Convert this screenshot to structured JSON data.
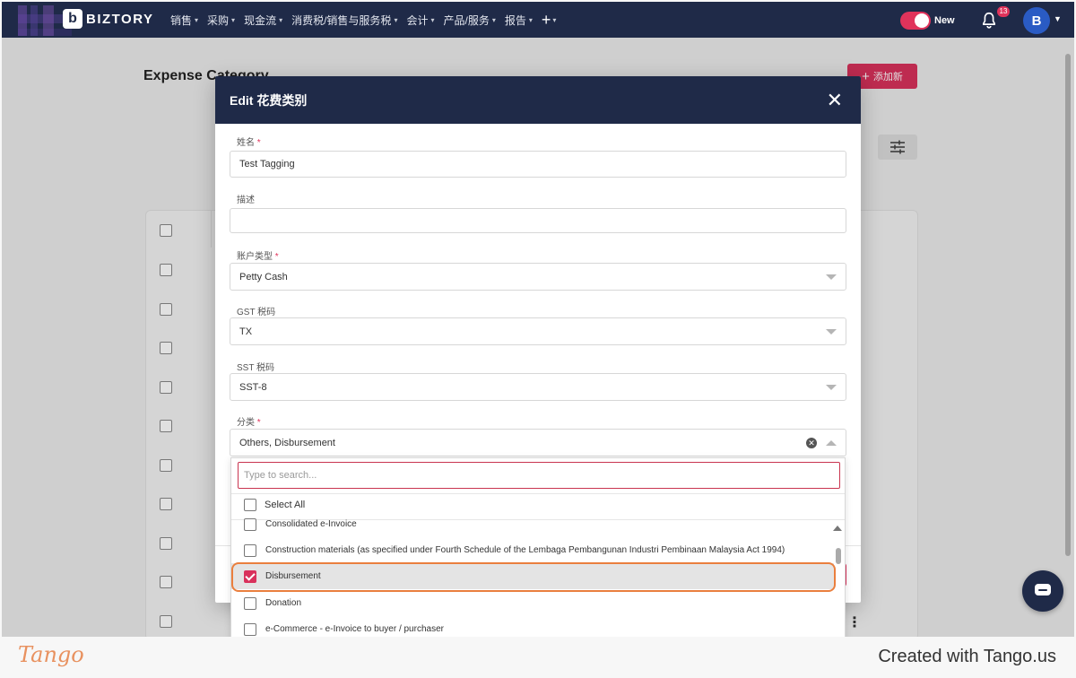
{
  "navbar": {
    "brand": "BIZTORY",
    "logo_letter": "b",
    "menu": [
      {
        "label": "销售"
      },
      {
        "label": "采购"
      },
      {
        "label": "现金流"
      },
      {
        "label": "消费税/销售与服务税"
      },
      {
        "label": "会计"
      },
      {
        "label": "产品/服务"
      },
      {
        "label": "报告"
      }
    ],
    "plus_label": "+",
    "toggle_label": "New",
    "notification_count": "13",
    "avatar_initial": "B"
  },
  "page": {
    "title": "Expense Category",
    "add_button": "添加新",
    "add_button_icon": "+"
  },
  "modal": {
    "title": "Edit 花费类别",
    "close": "✕",
    "fields": {
      "name_label": "姓名",
      "name_value": "Test Tagging",
      "description_label": "描述",
      "description_value": "",
      "account_type_label": "账户类型",
      "account_type_value": "Petty Cash",
      "gst_label": "GST 税码",
      "gst_value": "TX",
      "sst_label": "SST 税码",
      "sst_value": "SST-8",
      "category_label": "分类",
      "category_value": "Others, Disbursement",
      "required_mark": "*"
    }
  },
  "dropdown": {
    "search_placeholder": "Type to search...",
    "select_all": "Select All",
    "options": [
      {
        "label": "Consolidated e-Invoice",
        "checked": false
      },
      {
        "label": "Construction materials (as specified under Fourth Schedule of the Lembaga Pembangunan Industri Pembinaan Malaysia Act 1994)",
        "checked": false
      },
      {
        "label": "Disbursement",
        "checked": true
      },
      {
        "label": "Donation",
        "checked": false
      },
      {
        "label": "e-Commerce - e-Invoice to buyer / purchaser",
        "checked": false
      }
    ]
  },
  "footer": {
    "tango_logo": "Tango",
    "created_with": "Created with Tango.us"
  },
  "colors": {
    "navbar": "#1f2a48",
    "accent": "#d9315c",
    "highlight_ring": "#ea7f3e"
  }
}
